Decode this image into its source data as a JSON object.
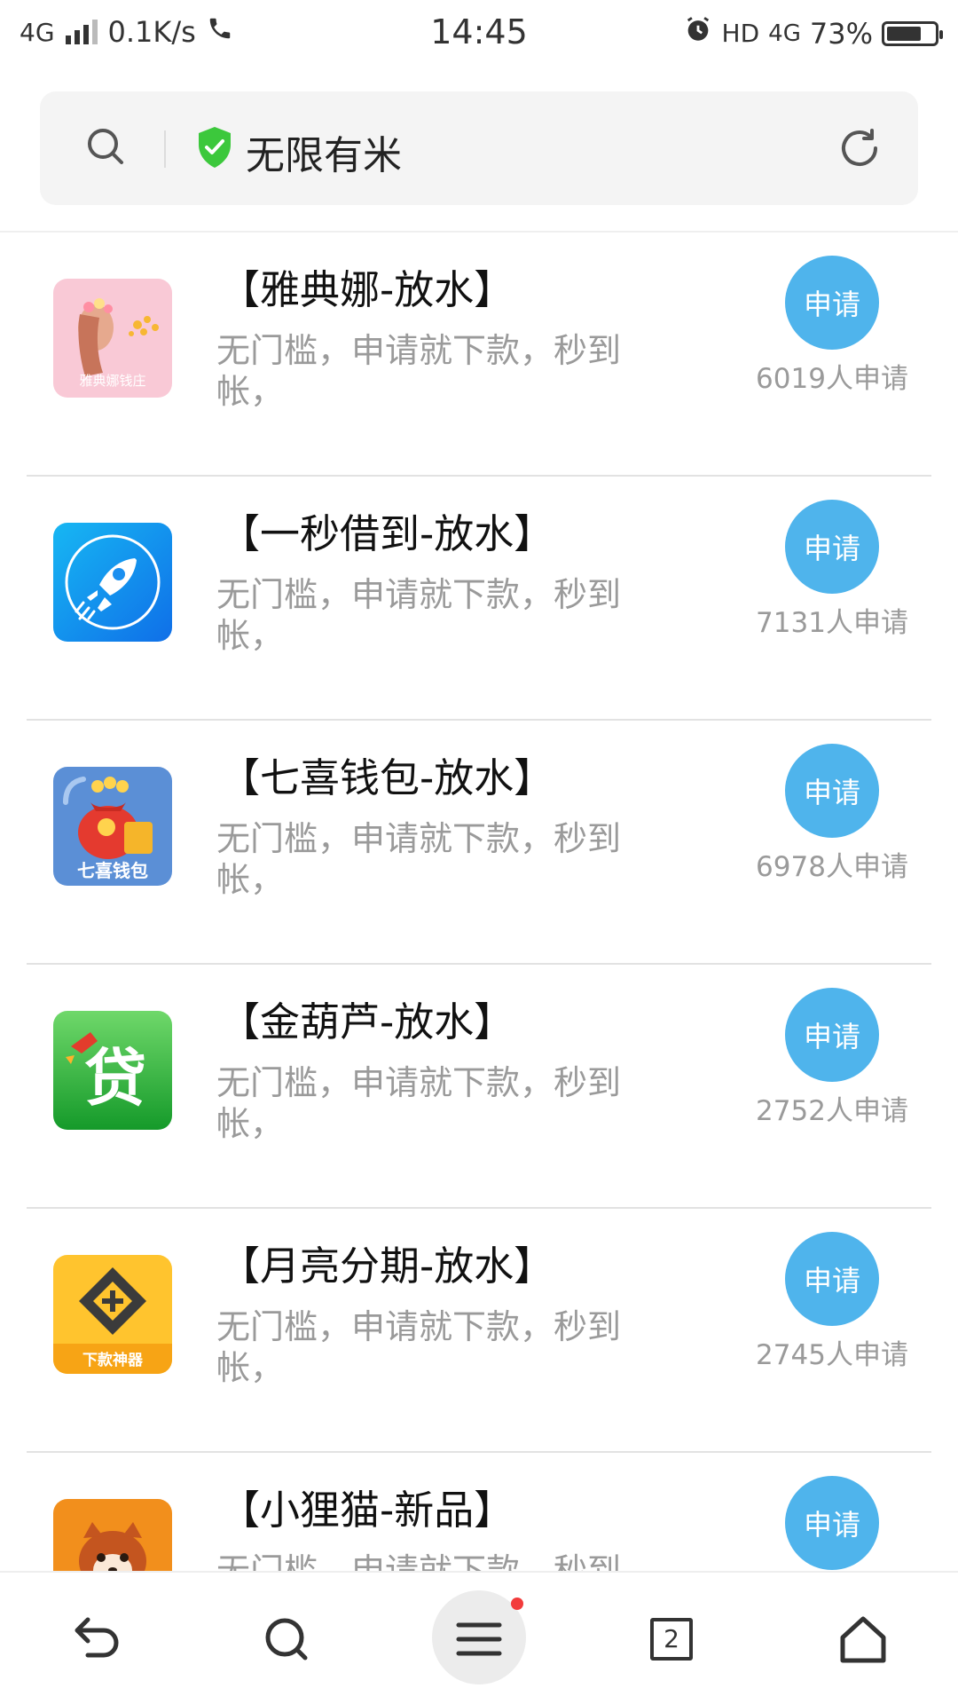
{
  "status_bar": {
    "network": "4G",
    "speed": "0.1K/s",
    "time": "14:45",
    "hd": "HD",
    "network_right": "4G",
    "battery_percent": "73%",
    "battery_level": 0.73
  },
  "search_bar": {
    "site_title": "无限有米"
  },
  "items": [
    {
      "title": "【雅典娜-放水】",
      "desc": "无门槛，申请就下款，秒到帐，",
      "apply": "申请",
      "count": "6019人申请",
      "icon": "yadianna-app-icon",
      "icon_text": "雅典娜钱庄"
    },
    {
      "title": "【一秒借到-放水】",
      "desc": "无门槛，申请就下款，秒到帐，",
      "apply": "申请",
      "count": "7131人申请",
      "icon": "rocket-app-icon"
    },
    {
      "title": "【七喜钱包-放水】",
      "desc": "无门槛，申请就下款，秒到帐，",
      "apply": "申请",
      "count": "6978人申请",
      "icon": "qixi-wallet-app-icon",
      "icon_text": "七喜钱包"
    },
    {
      "title": "【金葫芦-放水】",
      "desc": "无门槛，申请就下款，秒到帐，",
      "apply": "申请",
      "count": "2752人申请",
      "icon": "dai-app-icon",
      "icon_text": "贷"
    },
    {
      "title": "【月亮分期-放水】",
      "desc": "无门槛，申请就下款，秒到帐，",
      "apply": "申请",
      "count": "2745人申请",
      "icon": "xiakuan-shenqi-app-icon",
      "icon_text": "下款神器"
    },
    {
      "title": "【小狸猫-新品】",
      "desc": "无门槛，申请就下款，秒到帐，",
      "apply": "申请",
      "count": "",
      "icon": "red-panda-app-icon"
    }
  ],
  "bottom_nav": {
    "tab_count": "2"
  },
  "colors": {
    "accent": "#4fb4ec",
    "muted_text": "#9a9a9a",
    "shield": "#3cc83c",
    "badge_red": "#f23b3b"
  }
}
